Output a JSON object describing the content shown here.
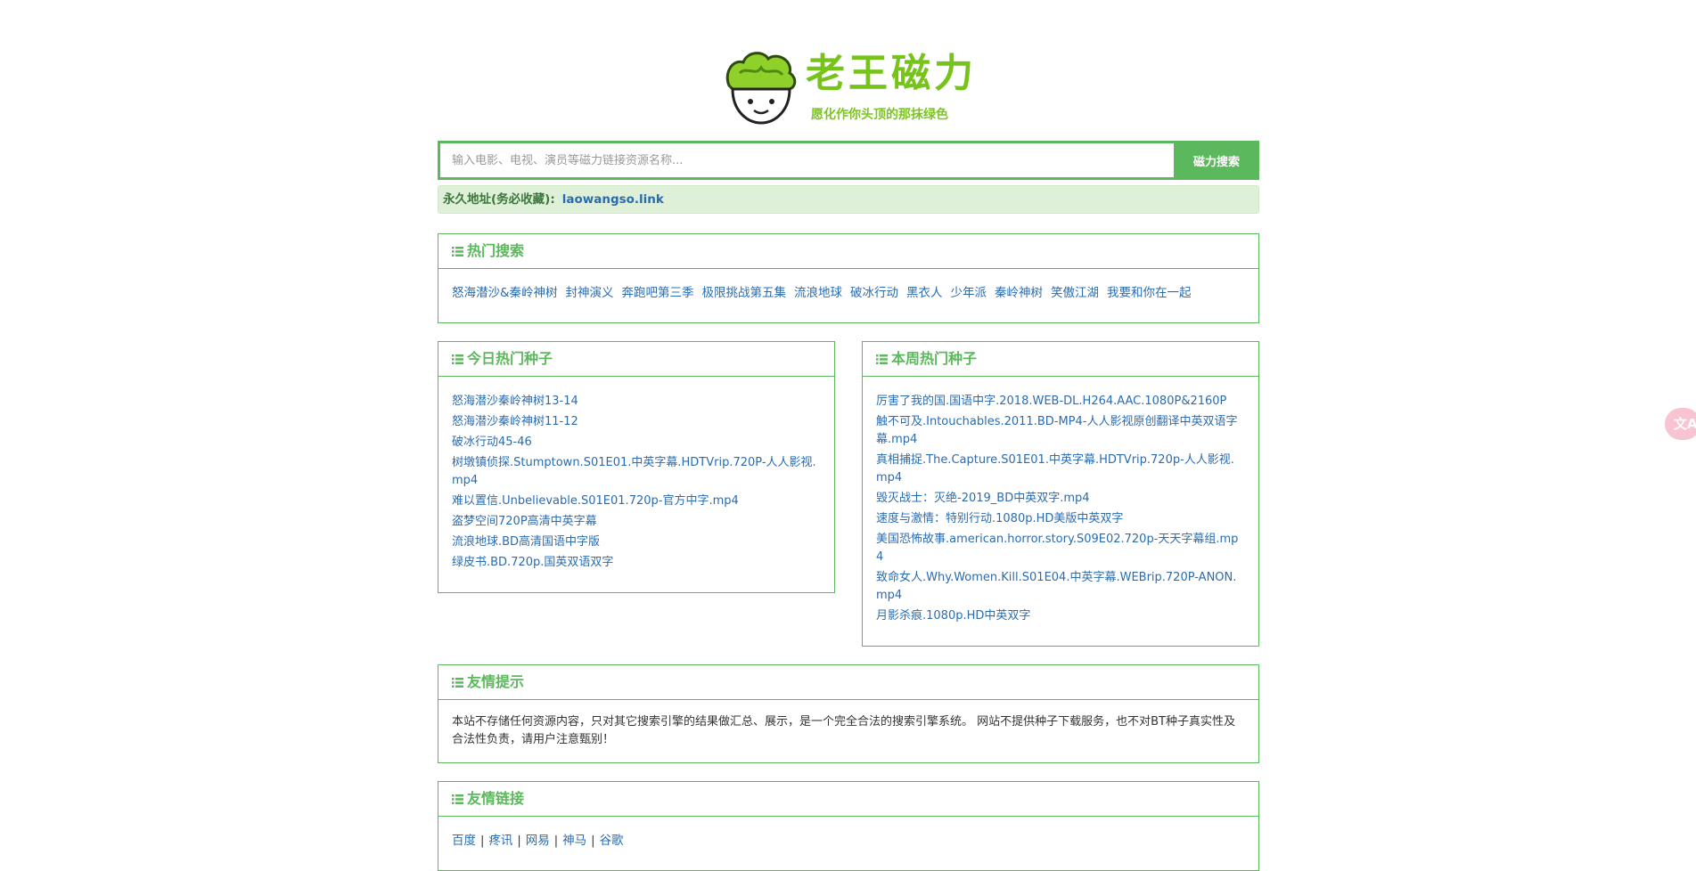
{
  "logo": {
    "title": "老王磁力",
    "slogan": "愿化作你头顶的那抹绿色"
  },
  "search": {
    "placeholder": "输入电影、电视、演员等磁力链接资源名称...",
    "button_label": "磁力搜索"
  },
  "notice": {
    "label": "永久地址(务必收藏):",
    "url_text": "laowangso.link"
  },
  "hot_search": {
    "title": "热门搜索",
    "items": [
      "怒海潜沙&秦岭神树",
      "封神演义",
      "奔跑吧第三季",
      "极限挑战第五集",
      "流浪地球",
      "破冰行动",
      "黑衣人",
      "少年派",
      "秦岭神树",
      "笑傲江湖",
      "我要和你在一起"
    ]
  },
  "today_seeds": {
    "title": "今日热门种子",
    "items": [
      "怒海潜沙秦岭神树13-14",
      "怒海潜沙秦岭神树11-12",
      "破冰行动45-46",
      "树墩镇侦探.Stumptown.S01E01.中英字幕.HDTVrip.720P-人人影视.mp4",
      "难以置信.Unbelievable.S01E01.720p-官方中字.mp4",
      "盗梦空间720P高清中英字幕",
      "流浪地球.BD高清国语中字版",
      "绿皮书.BD.720p.国英双语双字"
    ]
  },
  "week_seeds": {
    "title": "本周热门种子",
    "items": [
      "厉害了我的国.国语中字.2018.WEB-DL.H264.AAC.1080P&2160P",
      "触不可及.Intouchables.2011.BD-MP4-人人影视原创翻译中英双语字幕.mp4",
      "真相捕捉.The.Capture.S01E01.中英字幕.HDTVrip.720p-人人影视.mp4",
      "毁灭战士：灭绝-2019_BD中英双字.mp4",
      "速度与激情：特别行动.1080p.HD美版中英双字",
      "美国恐怖故事.american.horror.story.S09E02.720p-天天字幕组.mp4",
      "致命女人.Why.Women.Kill.S01E04.中英字幕.WEBrip.720P-ANON.mp4",
      "月影杀痕.1080p.HD中英双字"
    ]
  },
  "tips": {
    "title": "友情提示",
    "text": "本站不存储任何资源内容，只对其它搜索引擎的结果做汇总、展示，是一个完全合法的搜索引擎系统。 网站不提供种子下载服务，也不对BT种子真实性及合法性负责，请用户注意甄别！"
  },
  "friend_links": {
    "title": "友情链接",
    "items": [
      "百度",
      "疼讯",
      "网易",
      "神马",
      "谷歌"
    ],
    "separator": "|"
  },
  "side_widget": {
    "label": "文A"
  },
  "colors": {
    "accent": "#5cb85c",
    "link": "#2a6cb0",
    "logo_green": "#76c41a"
  }
}
